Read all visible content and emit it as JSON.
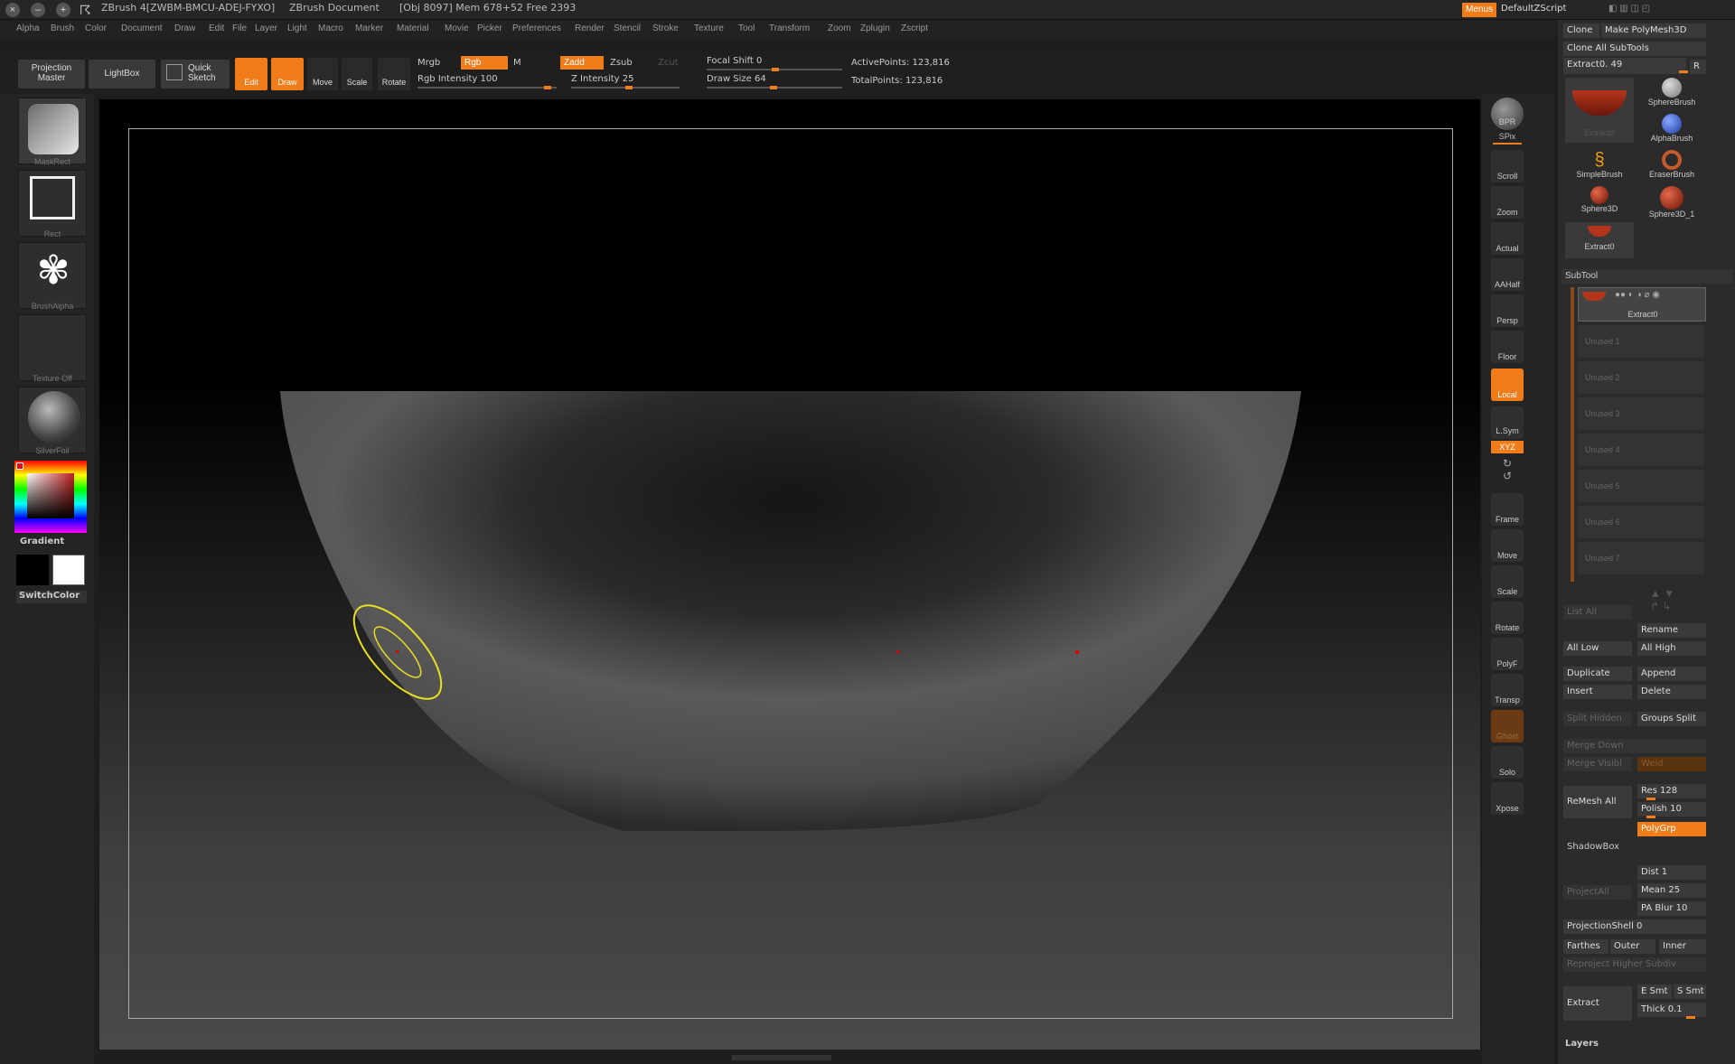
{
  "title_bar": {
    "app": "ZBrush 4[ZWBM-BMCU-ADEJ-FYXO]",
    "document": "ZBrush Document",
    "stats": "[Obj 8097] Mem 678+52 Free 2393",
    "menus_button": "Menus",
    "script": "DefaultZScript"
  },
  "menubar": [
    "Alpha",
    "Brush",
    "Color",
    "Document",
    "Draw",
    "Edit",
    "File",
    "Layer",
    "Light",
    "Macro",
    "Marker",
    "Material",
    "Movie",
    "Picker",
    "Preferences",
    "Render",
    "Stencil",
    "Stroke",
    "Texture",
    "Tool",
    "Transform",
    "Zoom",
    "Zplugin",
    "Zscript"
  ],
  "toolbar": {
    "projection_master": "Projection Master",
    "lightbox": "LightBox",
    "quick_sketch": "Quick Sketch",
    "edit": "Edit",
    "draw": "Draw",
    "move": "Move",
    "scale": "Scale",
    "rotate": "Rotate",
    "mrgb": "Mrgb",
    "rgb": "Rgb",
    "m": "M",
    "rgb_intensity": "Rgb Intensity 100",
    "zadd": "Zadd",
    "zsub": "Zsub",
    "zcut": "Zcut",
    "z_intensity": "Z Intensity 25",
    "focal_shift": "Focal Shift 0",
    "draw_size": "Draw Size 64",
    "active_points": "ActivePoints: 123,816",
    "total_points": "TotalPoints: 123,816",
    "rgb_intensity_value": 100,
    "z_intensity_value": 25,
    "draw_size_value": 64
  },
  "left_shelf": {
    "maskrect": "MaskRect",
    "rect": "Rect",
    "brushalpha": "BrushAlpha",
    "texture": "Texture Off",
    "material": "SilverFoil",
    "gradient": "Gradient",
    "switchcolor": "SwitchColor"
  },
  "right_shelf": [
    "BPR",
    "SPix",
    "Scroll",
    "Zoom",
    "Actual",
    "AAHalf",
    "Persp",
    "Floor",
    "Local",
    "L.Sym",
    "XYZ",
    "Frame",
    "Move",
    "Scale",
    "Rotate",
    "PolyF",
    "Transp",
    "Ghost",
    "Solo",
    "Xpose"
  ],
  "tool_panel": {
    "clone": "Clone",
    "make_polymesh": "Make PolyMesh3D",
    "clone_all": "Clone All SubTools",
    "extract_slider": "Extract0. 49",
    "r": "R",
    "current_tool": "Extract0",
    "tools": [
      "SphereBrush",
      "AlphaBrush",
      "SimpleBrush",
      "EraserBrush",
      "Sphere3D",
      "Sphere3D_1",
      "Extract0"
    ]
  },
  "subtool": {
    "header": "SubTool",
    "active": "Extract0",
    "unused": [
      "Unused 1",
      "Unused 2",
      "Unused 3",
      "Unused 4",
      "Unused 5",
      "Unused 6",
      "Unused 7"
    ],
    "list_all": "List All",
    "rename": "Rename",
    "all_low": "All Low",
    "all_high": "All High",
    "duplicate": "Duplicate",
    "append": "Append",
    "insert": "Insert",
    "delete": "Delete",
    "split_hidden": "Split Hidden",
    "groups_split": "Groups Split",
    "merge_down": "Merge Down",
    "merge_visible": "Merge Visibl",
    "weld": "Weld",
    "remesh_all": "ReMesh All",
    "res": "Res 128",
    "polish": "Polish 10",
    "polygrp": "PolyGrp",
    "shadowbox": "ShadowBox",
    "dist": "Dist 1",
    "mean": "Mean 25",
    "pa_blur": "PA Blur 10",
    "project_all": "ProjectAll",
    "projection_shell": "ProjectionShell 0",
    "farthest": "Farthes",
    "outer": "Outer",
    "inner": "Inner",
    "reproject": "Reproject Higher Subdiv",
    "extract": "Extract",
    "e_smt": "E Smt",
    "s_smt": "S Smt",
    "thick": "Thick 0.1",
    "layers": "Layers"
  }
}
